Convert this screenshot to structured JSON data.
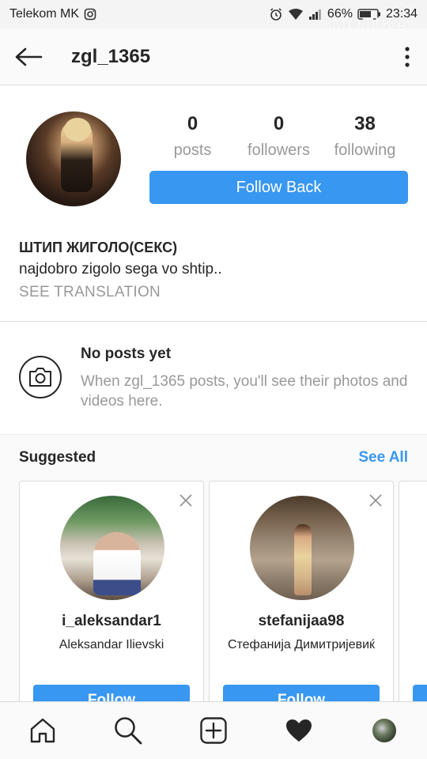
{
  "status_bar": {
    "carrier": "Telekom MK",
    "battery": "66%",
    "time": "23:34",
    "watermark": "MOTIKA"
  },
  "header": {
    "username": "zgl_1365"
  },
  "stats": [
    {
      "value": "0",
      "label": "posts"
    },
    {
      "value": "0",
      "label": "followers"
    },
    {
      "value": "38",
      "label": "following"
    }
  ],
  "profile": {
    "follow_back_label": "Follow Back",
    "bio_name": "ШТИП ЖИГОЛО(СЕКС)",
    "bio_text": "najdobro zigolo sega vo shtip..",
    "see_translation": "SEE TRANSLATION"
  },
  "no_posts": {
    "title": "No posts yet",
    "text": "When zgl_1365 posts, you'll see their photos and videos here."
  },
  "suggested": {
    "title": "Suggested",
    "see_all": "See All",
    "cards": [
      {
        "username": "i_aleksandar1",
        "full_name": "Aleksandar Ilievski",
        "follow_label": "Follow"
      },
      {
        "username": "stefanijaa98",
        "full_name": "Стефанија Димитријевиќ",
        "follow_label": "Follow"
      }
    ]
  },
  "icons": {
    "back": "arrow-left-icon",
    "more": "more-vertical-icon",
    "camera": "camera-icon",
    "close": "close-icon",
    "home": "home-icon",
    "search": "search-icon",
    "add": "add-post-icon",
    "activity": "heart-icon",
    "profile": "profile-avatar"
  },
  "colors": {
    "accent": "#3897f0",
    "muted": "#999999",
    "text": "#262626"
  }
}
